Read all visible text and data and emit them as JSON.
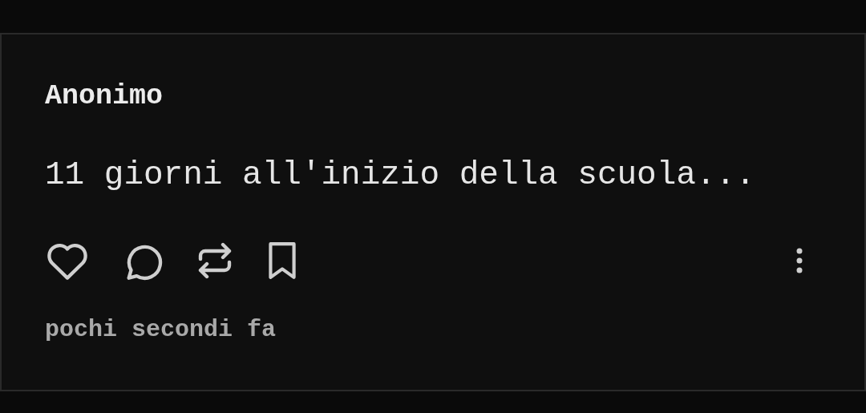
{
  "post": {
    "author": "Anonimo",
    "text": "11 giorni all'inizio della scuola...",
    "timestamp": "pochi secondi fa"
  }
}
